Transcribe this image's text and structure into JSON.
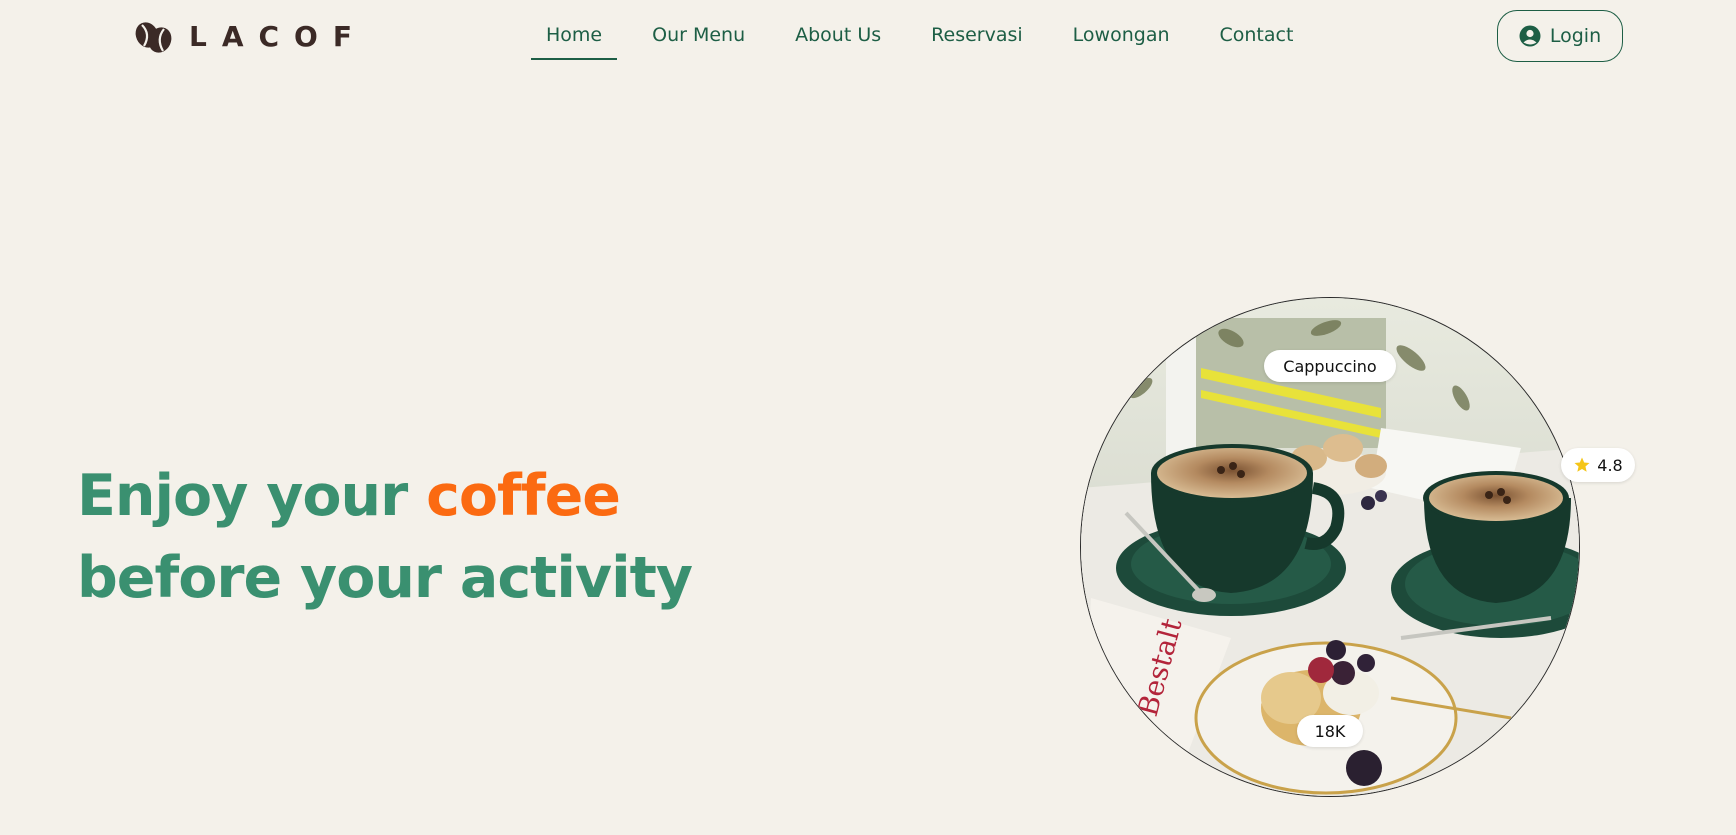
{
  "brand": {
    "name": "LACOF",
    "logo_icon": "coffee-beans-icon",
    "color": "#3b2a26"
  },
  "nav": {
    "items": [
      {
        "label": "Home",
        "active": true
      },
      {
        "label": "Our Menu",
        "active": false
      },
      {
        "label": "About Us",
        "active": false
      },
      {
        "label": "Reservasi",
        "active": false
      },
      {
        "label": "Lowongan",
        "active": false
      },
      {
        "label": "Contact",
        "active": false
      }
    ],
    "color": "#1d5e45"
  },
  "login": {
    "label": "Login",
    "icon": "user-circle-icon"
  },
  "hero": {
    "line1_prefix": "Enjoy your ",
    "line1_accent": "coffee",
    "line2": "before your activity",
    "text_color": "#3a9070",
    "accent_color": "#fb6a11"
  },
  "product_card": {
    "name": "Cappuccino",
    "rating": "4.8",
    "rating_icon": "star-icon",
    "sold": "18K"
  },
  "colors": {
    "background": "#f4f1ea",
    "star": "#f5c518"
  }
}
